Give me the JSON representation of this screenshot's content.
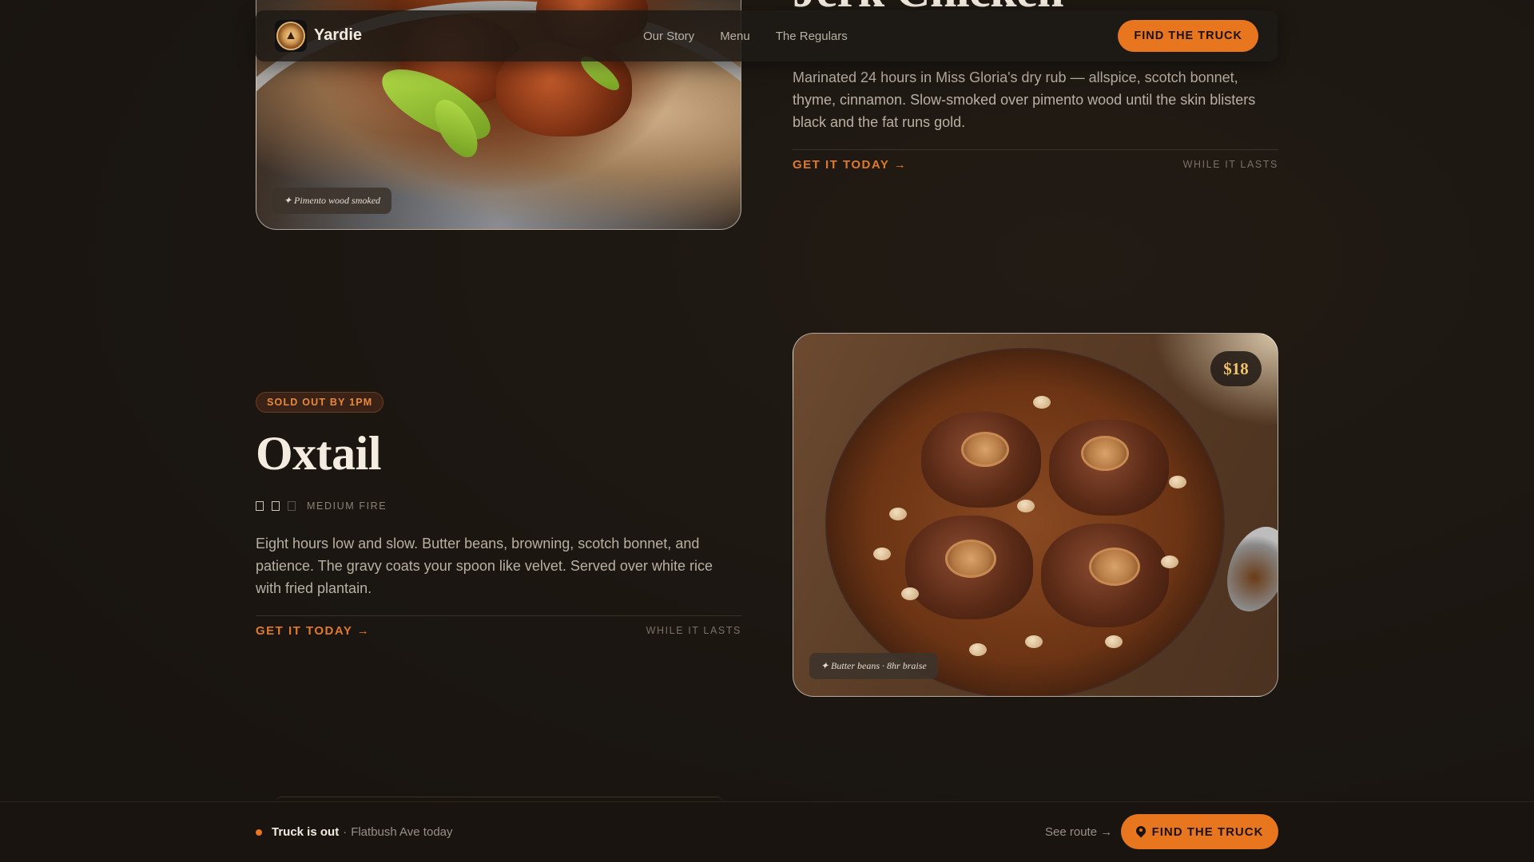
{
  "header": {
    "brand": "Yardie",
    "nav": [
      "Our Story",
      "Menu",
      "The Regulars"
    ],
    "cta": "FIND THE TRUCK"
  },
  "jerk": {
    "title": "Jerk Chicken",
    "description": "Marinated 24 hours in Miss Gloria's dry rub — allspice, scotch bonnet, thyme, cinnamon. Slow-smoked over pimento wood until the skin blisters black and the fat runs gold.",
    "cta": "GET IT TODAY →",
    "availability": "WHILE IT LASTS",
    "photo_tag": "✦ Pimento wood smoked"
  },
  "oxtail": {
    "badge": "SOLD OUT BY 1PM",
    "title": "Oxtail",
    "heat_label": "MEDIUM FIRE",
    "heat_level": 2,
    "heat_max": 3,
    "description": "Eight hours low and slow. Butter beans, browning, scotch bonnet, and patience. The gravy coats your spoon like velvet. Served over white rice with fried plantain.",
    "cta": "GET IT TODAY →",
    "availability": "WHILE IT LASTS",
    "price": "$18",
    "photo_tag": "✦ Butter beans · 8hr braise"
  },
  "bottom_bar": {
    "status_strong": "Truck is out",
    "status_separator": "·",
    "status_location": "Flatbush Ave today",
    "see_route": "See route →",
    "cta": "FIND THE TRUCK"
  },
  "colors": {
    "accent": "#e8761f",
    "background": "#1b1611",
    "price": "#f0c36a"
  }
}
